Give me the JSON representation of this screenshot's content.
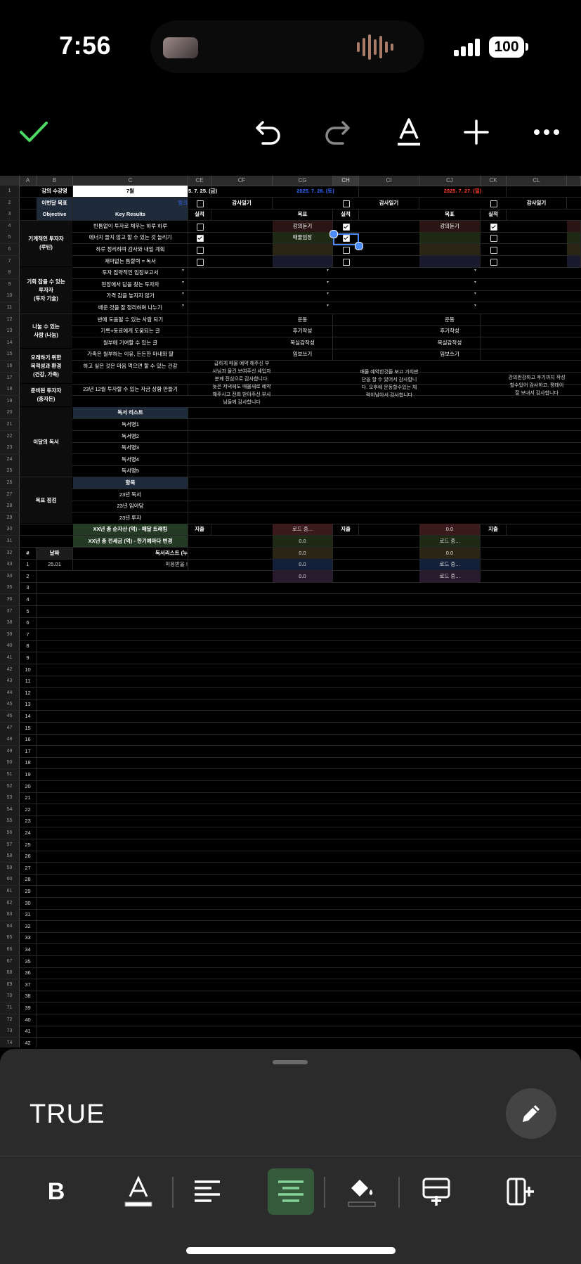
{
  "status_bar": {
    "time": "7:56",
    "battery": "100"
  },
  "toolbar": {
    "done": "done-check-icon",
    "undo": "undo-icon",
    "redo": "redo-icon",
    "text_format": "text-format-icon",
    "add": "add-icon",
    "more": "more-icon"
  },
  "sheet": {
    "columns": [
      "A",
      "B",
      "C",
      "CE",
      "CF",
      "CG",
      "CH",
      "CI",
      "CJ",
      "CK",
      "CL"
    ],
    "selected_column": "CH",
    "r1": {
      "label": "강의 수강명",
      "month": "7월",
      "date1": "5. 7. 25. (금)",
      "date2": "2025. 7. 26. (토)",
      "date3": "2025. 7. 27. (일)"
    },
    "r2": {
      "label": "이번달 목표",
      "link": "링크",
      "diary1": "감사일기",
      "diary2": "감사일기",
      "diary3": "감사일기"
    },
    "r3": {
      "objective": "Objective",
      "kr": "Key Results",
      "actual": "실적",
      "goal": "목표",
      "actual2": "실적",
      "goal3": "목표",
      "actual3": "실적"
    },
    "objectives": {
      "o1": "기계적인 투자자\n(루틴)",
      "o2": "기회 잡을 수 있는\n투자자\n(투자 기술)",
      "o3": "나눌 수 있는\n사람 (나눔)",
      "o4": "오래하기 위한\n목적성과 환경\n(건강, 가족)",
      "o5": "준비된 투자자\n(종자돈)",
      "o6": "이달의 독서",
      "o7": "목표 점검"
    },
    "key_results": {
      "r4": "빈틈없이 투자로 채우는 하루 하루",
      "r5": "에너지 들지 않고 할 수 있는 것 늘리기",
      "r6": "하루 정리하며 감사와 내일 계획",
      "r7": "재미없는 틈할력 = 독서",
      "r8": "투자 집약적인 임장보고서",
      "r9": "현장에서 답을 찾는 투자자",
      "r10": "가격 감을 놓지지 않기",
      "r11": "배운 것을 잘 정리하며 나누기",
      "r12": "반에 도움될 수 있는 사람 되기",
      "r13": "기록+동료에게 도움되는 글",
      "r14": "월부에 기여할 수 있는 글",
      "r15": "가족은 월부하는 이유, 든든한 마내와 딸",
      "r16": "하고 싶은 것은 마음 먹으면 할 수 있는 건강",
      "r18": "23년 12월 투자할 수 있는 자금 상황 만들기",
      "r20": "독서 리스트",
      "r21": "독서명1",
      "r22": "독서명2",
      "r23": "독서명3",
      "r24": "독서명4",
      "r25": "독서명5",
      "r26": "항목",
      "r27": "23년 독서",
      "r28": "23년 임야당",
      "r29": "23년 투자",
      "r30": "XX년 총 순자산 (억) - 매달 트래킹",
      "r31": "XX년 총 전세금 (억) - 한기예마다 변경"
    },
    "cg_goals": {
      "r4": "강의듣기",
      "r5": "매물임장",
      "r12": "운동",
      "r13": "후기작성",
      "r14": "목실감작성",
      "r15": "임보쓰기"
    },
    "cj_goals": {
      "r4": "강의듣기",
      "r12": "운동",
      "r13": "후기작성",
      "r14": "목실감작성",
      "r15": "임보쓰기"
    },
    "notes": {
      "cf": "급하게 매물 예약 해주신 부사님과 물건 보여주신 세입자분께 진심으로 감사합니다. 늦은 저녁에도 매물새로 예약해주시고 전화 받아주신 부사님들께 감사합니다",
      "ci": "매물 예약한것들 보고 가치판단을 할 수 있어서 감사합니다. 오후에 운동할수있는 체력이남아서 감사합니다",
      "cl": "강의완강하고 후기까지 작성할수있어 감사하고, 평데이 잘 보내서 감사합니다"
    },
    "r30_extra": {
      "ce": "지출",
      "cg": "로드 중...",
      "ch": "지출",
      "cj": "0.0",
      "ck": "지출"
    },
    "r31_extra": {
      "cg": "0.0",
      "cj": "로드 중..."
    },
    "r32": {
      "hash": "#",
      "date": "날짜",
      "list": "독서리스트 (누",
      "cg": "0.0",
      "cj": "0.0"
    },
    "r33": {
      "num": "1",
      "date": "25.01",
      "c": "미용받을 !",
      "cg": "0.0",
      "cj": "로드 중..."
    },
    "r34": {
      "num": "2",
      "cg": "0.0",
      "cj": "로드 중..."
    },
    "checks": {
      "ce": [
        false,
        true,
        false,
        false
      ],
      "ch": [
        true,
        true,
        false,
        false
      ],
      "ck": [
        true,
        false,
        false,
        false
      ],
      "r2_ce": false,
      "r2_ch": false,
      "r2_ck": false
    }
  },
  "panel": {
    "formula_value": "TRUE"
  },
  "format_bar": [
    "bold-icon",
    "text-color-icon",
    "align-left-icon",
    "align-center-icon",
    "fill-color-icon",
    "insert-row-icon",
    "insert-column-icon"
  ],
  "colors": {
    "accent_green": "#4cd964",
    "active_format": "#355b3c",
    "date_blue": "#3366ff",
    "date_red": "#ff3b30"
  }
}
